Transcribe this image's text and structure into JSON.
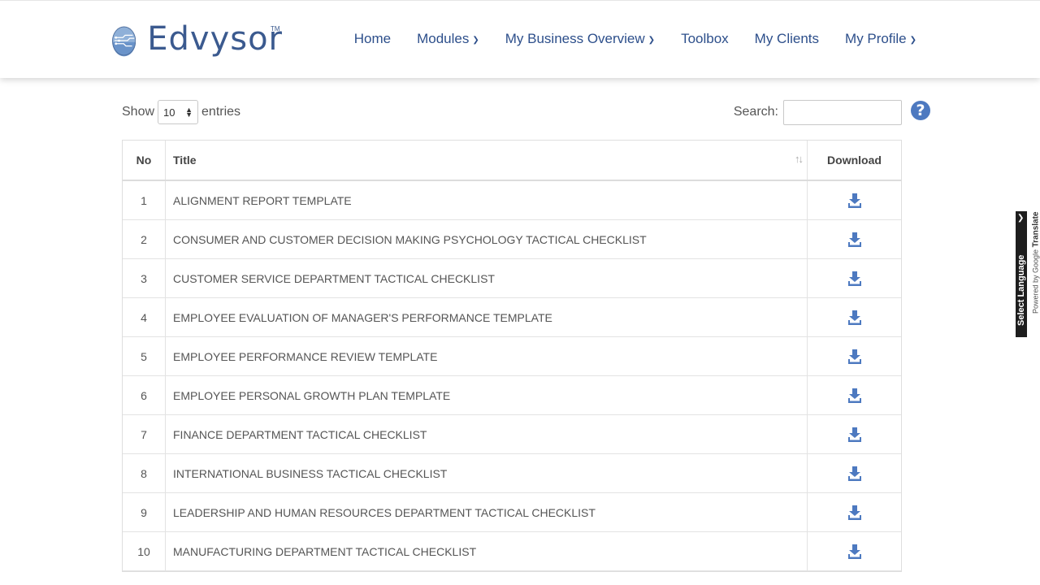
{
  "brand": {
    "name": "Edvysor",
    "tm": "TM"
  },
  "nav": [
    {
      "label": "Home",
      "dropdown": false
    },
    {
      "label": "Modules",
      "dropdown": true
    },
    {
      "label": "My Business Overview",
      "dropdown": true
    },
    {
      "label": "Toolbox",
      "dropdown": false
    },
    {
      "label": "My Clients",
      "dropdown": false
    },
    {
      "label": "My Profile",
      "dropdown": true
    }
  ],
  "controls": {
    "show_label": "Show",
    "entries_value": "10",
    "entries_label": "entries",
    "search_label": "Search:",
    "search_value": "",
    "help": "?"
  },
  "table": {
    "headers": {
      "no": "No",
      "title": "Title",
      "download": "Download"
    },
    "rows": [
      {
        "no": "1",
        "title": "ALIGNMENT REPORT TEMPLATE"
      },
      {
        "no": "2",
        "title": "CONSUMER AND CUSTOMER DECISION MAKING PSYCHOLOGY TACTICAL CHECKLIST"
      },
      {
        "no": "3",
        "title": "CUSTOMER SERVICE DEPARTMENT TACTICAL CHECKLIST"
      },
      {
        "no": "4",
        "title": "EMPLOYEE EVALUATION OF MANAGER'S PERFORMANCE TEMPLATE"
      },
      {
        "no": "5",
        "title": "EMPLOYEE PERFORMANCE REVIEW TEMPLATE"
      },
      {
        "no": "6",
        "title": "EMPLOYEE PERSONAL GROWTH PLAN TEMPLATE"
      },
      {
        "no": "7",
        "title": "FINANCE DEPARTMENT TACTICAL CHECKLIST"
      },
      {
        "no": "8",
        "title": "INTERNATIONAL BUSINESS TACTICAL CHECKLIST"
      },
      {
        "no": "9",
        "title": "LEADERSHIP AND HUMAN RESOURCES DEPARTMENT TACTICAL CHECKLIST"
      },
      {
        "no": "10",
        "title": "MANUFACTURING DEPARTMENT TACTICAL CHECKLIST"
      }
    ]
  },
  "translate": {
    "select_label": "Select Language",
    "powered_by": "Powered by",
    "google": "Google",
    "translate": "Translate"
  },
  "colors": {
    "brand_blue": "#3b5a8f",
    "nav_blue": "#2d4f8b",
    "icon_blue": "#4d79c0"
  }
}
